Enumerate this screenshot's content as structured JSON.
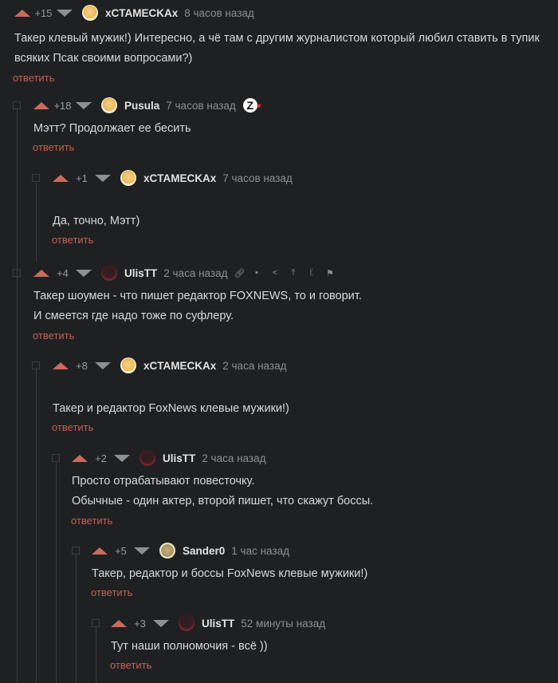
{
  "reply_label": "ответить",
  "comments": [
    {
      "rating": "+15",
      "author": "xCTAMECKAx",
      "time": "8 часов назад",
      "lines": [
        "Такер клевый мужик!) Интересно, а чё там с другим журналистом который любил ставить в тупик",
        "всяких Псак своими вопросами?)"
      ]
    },
    {
      "rating": "+18",
      "author": "Pusula",
      "time": "7 часов назад",
      "badge": "Z",
      "lines": [
        "Мэтт? Продолжает ее бесить"
      ]
    },
    {
      "rating": "+1",
      "author": "xCTAMECKAx",
      "time": "7 часов назад",
      "lines": [
        "Да, точно, Мэтт)"
      ]
    },
    {
      "rating": "+4",
      "author": "UlisTT",
      "time": "2 часа назад",
      "lines": [
        "Такер шоумен - что пишет редактор FOXNEWS, то и говорит.",
        "И смеется где надо тоже по суфлеру."
      ]
    },
    {
      "rating": "+8",
      "author": "xCTAMECKAx",
      "time": "2 часа назад",
      "lines": [
        "Такер и редактор FoxNews клевые мужики!)"
      ]
    },
    {
      "rating": "+2",
      "author": "UlisTT",
      "time": "2 часа назад",
      "lines": [
        "Просто отрабатывают повесточку.",
        "Обычные -  один актер, второй пишет, что скажут боссы."
      ]
    },
    {
      "rating": "+5",
      "author": "Sander0",
      "time": "1 час назад",
      "lines": [
        "Такер, редактор и боссы FoxNews клевые мужики!)"
      ]
    },
    {
      "rating": "+3",
      "author": "UlisTT",
      "time": "52 минуты назад",
      "lines": [
        "Тут наши полномочия - всё ))"
      ]
    }
  ],
  "icons": {
    "upvote": "upvote-arrow-icon",
    "downvote": "downvote-arrow-icon",
    "collapse": "collapse-box-icon",
    "tools": [
      "link-icon",
      "save-icon",
      "share-icon",
      "to-top-icon",
      "branch-icon",
      "flag-icon"
    ]
  }
}
